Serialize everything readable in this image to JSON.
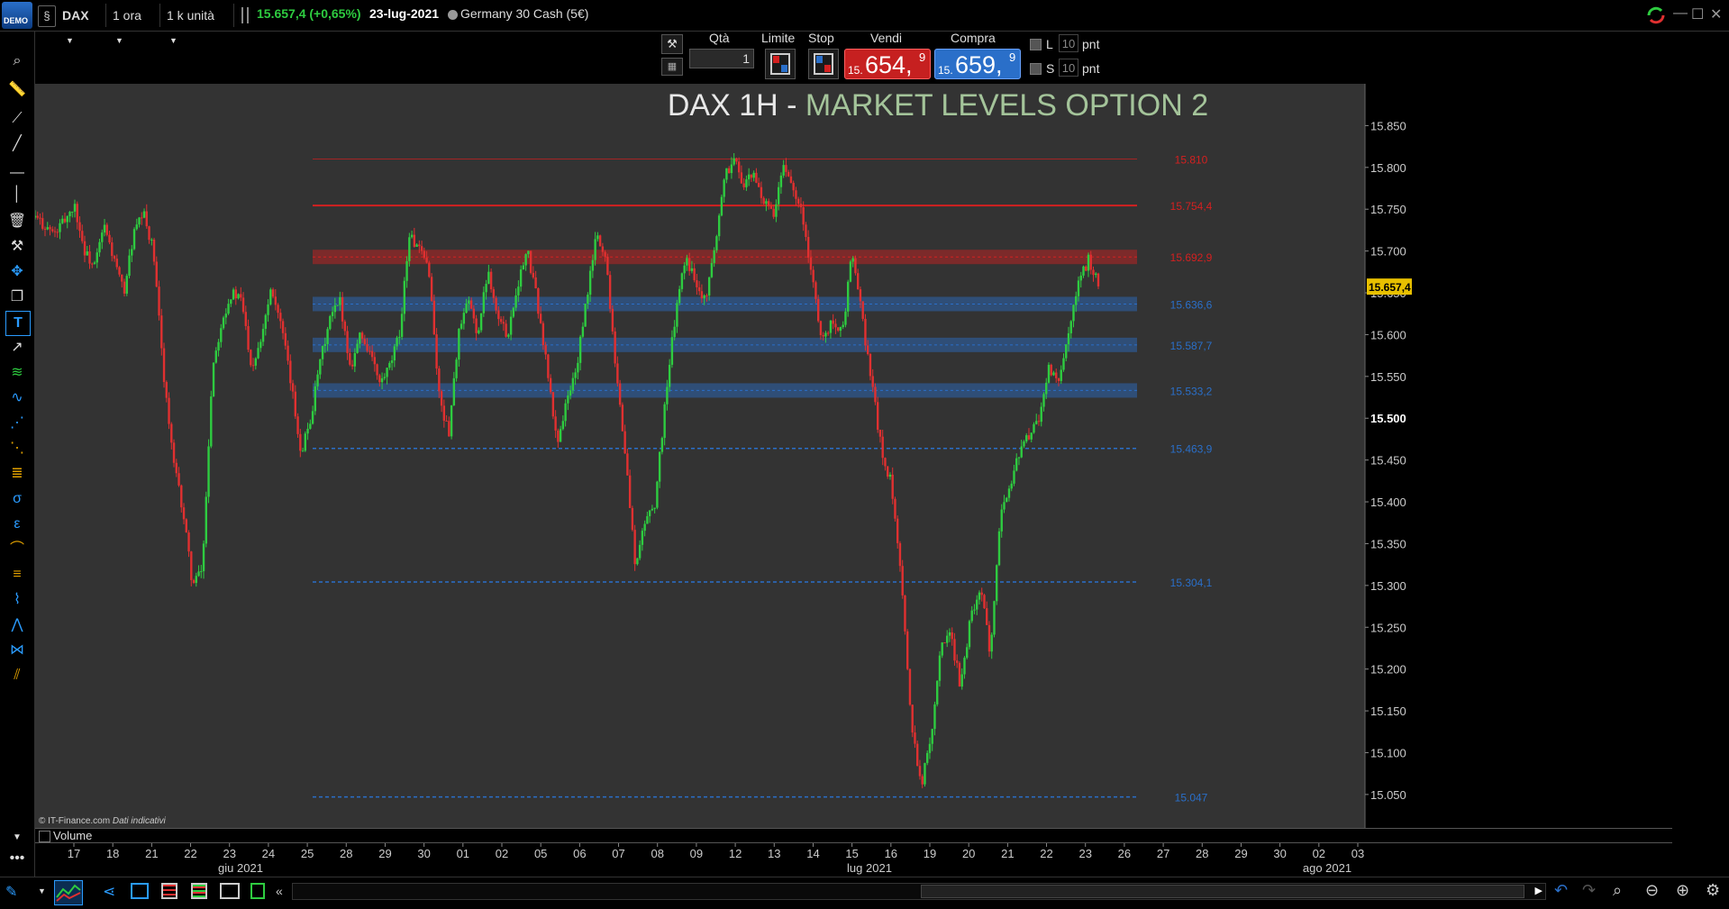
{
  "topbar": {
    "logo_text": "DEMO",
    "symbol": "DAX",
    "timeframe": "1 ora",
    "units": "1 k unità",
    "price_change": "15.657,4 (+0,65%)",
    "date": "23-lug-2021",
    "instrument": "Germany 30 Cash (5€)"
  },
  "trade_panel": {
    "qty_label": "Qtà",
    "qty_value": "1",
    "limit_label": "Limite",
    "stop_label": "Stop",
    "sell_label": "Vendi",
    "sell_prefix": "15.",
    "sell_big": "654,",
    "sell_sup": "9",
    "buy_label": "Compra",
    "buy_prefix": "15.",
    "buy_big": "659,",
    "buy_sup": "9",
    "l_label": "L",
    "l_value": "10",
    "s_label": "S",
    "s_value": "10",
    "pnt_label": "pnt"
  },
  "chart_data": {
    "type": "candlestick",
    "title_left": "DAX 1H - ",
    "title_right": "MARKET LEVELS OPTION 2",
    "ylim": [
      15010,
      15900
    ],
    "y_ticks": [
      "15.850",
      "15.800",
      "15.750",
      "15.700",
      "15.650",
      "15.600",
      "15.550",
      "15.500",
      "15.450",
      "15.400",
      "15.350",
      "15.300",
      "15.250",
      "15.200",
      "15.150",
      "15.100",
      "15.050"
    ],
    "y_tick_values": [
      15850,
      15800,
      15750,
      15700,
      15650,
      15600,
      15550,
      15500,
      15450,
      15400,
      15350,
      15300,
      15250,
      15200,
      15150,
      15100,
      15050
    ],
    "current_price_label": "15.657,4",
    "current_price": 15657.4,
    "levels": [
      {
        "value": 15810,
        "label": "15.810",
        "color": "#d42020",
        "style": "thin"
      },
      {
        "value": 15754.4,
        "label": "15.754,4",
        "color": "#d42020",
        "style": "line"
      },
      {
        "value": 15692.9,
        "label": "15.692,9",
        "color": "#d42020",
        "style": "band"
      },
      {
        "value": 15636.6,
        "label": "15.636,6",
        "color": "#2a6fc9",
        "style": "band"
      },
      {
        "value": 15587.7,
        "label": "15.587,7",
        "color": "#2a6fc9",
        "style": "band"
      },
      {
        "value": 15533.2,
        "label": "15.533,2",
        "color": "#2a6fc9",
        "style": "band"
      },
      {
        "value": 15463.9,
        "label": "15.463,9",
        "color": "#2a6fc9",
        "style": "dash"
      },
      {
        "value": 15304.1,
        "label": "15.304,1",
        "color": "#2a6fc9",
        "style": "dash"
      },
      {
        "value": 15047,
        "label": "15.047",
        "color": "#2a6fc9",
        "style": "dash"
      }
    ],
    "x_ticks": [
      "17",
      "18",
      "21",
      "22",
      "23",
      "24",
      "25",
      "28",
      "29",
      "30",
      "01",
      "02",
      "05",
      "06",
      "07",
      "08",
      "09",
      "12",
      "13",
      "14",
      "15",
      "16",
      "19",
      "20",
      "21",
      "22",
      "23",
      "26",
      "27",
      "28",
      "29",
      "30",
      "02",
      "03"
    ],
    "month_labels": [
      "giu 2021",
      "lug 2021",
      "ago 2021"
    ],
    "price_path": [
      [
        0,
        15740
      ],
      [
        2,
        15720
      ],
      [
        4,
        15755
      ],
      [
        5,
        15700
      ],
      [
        6,
        15680
      ],
      [
        7,
        15730
      ],
      [
        9,
        15650
      ],
      [
        10,
        15720
      ],
      [
        11,
        15745
      ],
      [
        12,
        15700
      ],
      [
        13,
        15560
      ],
      [
        14,
        15450
      ],
      [
        15,
        15390
      ],
      [
        16,
        15300
      ],
      [
        17,
        15320
      ],
      [
        18,
        15560
      ],
      [
        19,
        15620
      ],
      [
        20,
        15650
      ],
      [
        21,
        15640
      ],
      [
        22,
        15560
      ],
      [
        23,
        15600
      ],
      [
        24,
        15660
      ],
      [
        25,
        15610
      ],
      [
        26,
        15540
      ],
      [
        27,
        15460
      ],
      [
        28,
        15500
      ],
      [
        29,
        15570
      ],
      [
        30,
        15620
      ],
      [
        31,
        15640
      ],
      [
        32,
        15560
      ],
      [
        33,
        15600
      ],
      [
        34,
        15580
      ],
      [
        35,
        15540
      ],
      [
        36,
        15560
      ],
      [
        37,
        15600
      ],
      [
        38,
        15720
      ],
      [
        39,
        15700
      ],
      [
        40,
        15680
      ],
      [
        41,
        15530
      ],
      [
        42,
        15480
      ],
      [
        43,
        15600
      ],
      [
        44,
        15640
      ],
      [
        45,
        15600
      ],
      [
        46,
        15680
      ],
      [
        47,
        15620
      ],
      [
        48,
        15600
      ],
      [
        49,
        15660
      ],
      [
        50,
        15700
      ],
      [
        51,
        15640
      ],
      [
        52,
        15560
      ],
      [
        53,
        15470
      ],
      [
        54,
        15520
      ],
      [
        55,
        15560
      ],
      [
        56,
        15640
      ],
      [
        57,
        15720
      ],
      [
        58,
        15690
      ],
      [
        59,
        15560
      ],
      [
        60,
        15450
      ],
      [
        61,
        15320
      ],
      [
        62,
        15380
      ],
      [
        63,
        15400
      ],
      [
        64,
        15520
      ],
      [
        65,
        15620
      ],
      [
        66,
        15690
      ],
      [
        67,
        15670
      ],
      [
        68,
        15640
      ],
      [
        69,
        15700
      ],
      [
        70,
        15790
      ],
      [
        71,
        15810
      ],
      [
        72,
        15780
      ],
      [
        73,
        15790
      ],
      [
        74,
        15760
      ],
      [
        75,
        15740
      ],
      [
        76,
        15800
      ],
      [
        77,
        15780
      ],
      [
        78,
        15740
      ],
      [
        79,
        15660
      ],
      [
        80,
        15590
      ],
      [
        81,
        15620
      ],
      [
        82,
        15600
      ],
      [
        83,
        15700
      ],
      [
        84,
        15620
      ],
      [
        85,
        15540
      ],
      [
        86,
        15460
      ],
      [
        87,
        15420
      ],
      [
        88,
        15300
      ],
      [
        89,
        15140
      ],
      [
        90,
        15060
      ],
      [
        91,
        15120
      ],
      [
        92,
        15230
      ],
      [
        93,
        15240
      ],
      [
        94,
        15180
      ],
      [
        95,
        15260
      ],
      [
        96,
        15300
      ],
      [
        97,
        15220
      ],
      [
        98,
        15380
      ],
      [
        99,
        15420
      ],
      [
        100,
        15460
      ],
      [
        101,
        15480
      ],
      [
        102,
        15500
      ],
      [
        103,
        15560
      ],
      [
        104,
        15540
      ],
      [
        105,
        15600
      ],
      [
        106,
        15660
      ],
      [
        107,
        15690
      ],
      [
        108,
        15660
      ]
    ]
  },
  "volume_label": "Volume",
  "copyright": "© IT-Finance.com",
  "copyright_note": "Dati indicativi"
}
